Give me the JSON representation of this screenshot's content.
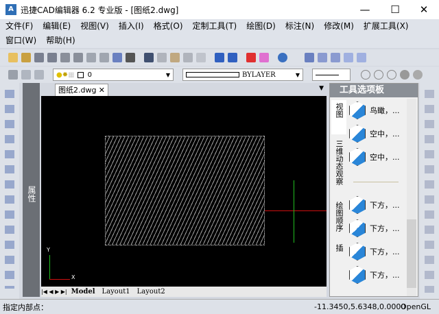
{
  "window": {
    "title": "迅捷CAD编辑器 6.2 专业版  - [图纸2.dwg]",
    "logo": "A",
    "minimize": "—",
    "maximize": "☐",
    "close": "✕"
  },
  "menu": [
    "文件(F)",
    "编辑(E)",
    "视图(V)",
    "插入(I)",
    "格式(O)",
    "定制工具(T)",
    "绘图(D)",
    "标注(N)",
    "修改(M)",
    "扩展工具(X)",
    "窗口(W)",
    "帮助(H)"
  ],
  "layer_combo": {
    "value": "0"
  },
  "linetype_combo": {
    "value": "BYLAYER"
  },
  "doc_tab": {
    "label": "图纸2.dwg",
    "close": "✕"
  },
  "properties_label": "属性",
  "layout_tabs": [
    "Model",
    "Layout1",
    "Layout2"
  ],
  "palette": {
    "title": "工具选项板",
    "tabs": [
      "视图",
      "三维动态观察",
      "绘图顺序",
      "插"
    ],
    "items": [
      "鸟瞰，...",
      "空中，...",
      "空中，...",
      "下方，...",
      "下方，...",
      "下方，...",
      "下方，..."
    ]
  },
  "status": {
    "prompt": "指定内部点：",
    "coords": "-11.3450,5.6348,0.0000",
    "renderer": "OpenGL"
  },
  "axis": {
    "x": "X",
    "y": "Y"
  },
  "colors": {
    "canvas": "#000000",
    "x_axis": "#d01010",
    "y_axis": "#20c020",
    "accent": "#2a86d8"
  }
}
